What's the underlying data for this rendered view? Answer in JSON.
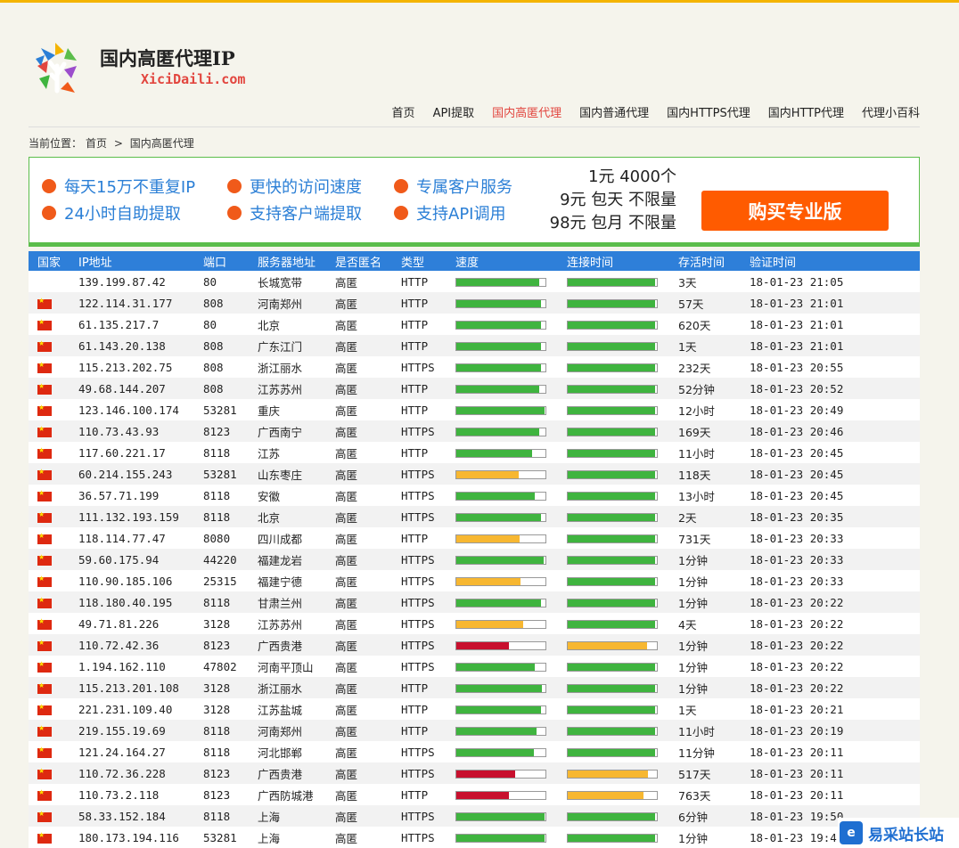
{
  "site": {
    "title": "国内高匿代理IP",
    "domain": "XiciDaili.com"
  },
  "nav": [
    {
      "label": "首页",
      "active": false
    },
    {
      "label": "API提取",
      "active": false
    },
    {
      "label": "国内高匿代理",
      "active": true
    },
    {
      "label": "国内普通代理",
      "active": false
    },
    {
      "label": "国内HTTPS代理",
      "active": false
    },
    {
      "label": "国内HTTP代理",
      "active": false
    },
    {
      "label": "代理小百科",
      "active": false
    }
  ],
  "breadcrumb": {
    "prefix": "当前位置：",
    "home": "首页",
    "sep": ">",
    "current": "国内高匿代理"
  },
  "promo": {
    "features": [
      "每天15万不重复IP",
      "更快的访问速度",
      "专属客户服务",
      "24小时自助提取",
      "支持客户端提取",
      "支持API调用"
    ],
    "prices": [
      "1元 4000个",
      "9元 包天 不限量",
      "98元 包月 不限量"
    ],
    "buy_label": "购买专业版"
  },
  "table": {
    "headers": [
      "国家",
      "IP地址",
      "端口",
      "服务器地址",
      "是否匿名",
      "类型",
      "速度",
      "连接时间",
      "存活时间",
      "验证时间"
    ],
    "rows": [
      {
        "flag": false,
        "ip": "139.199.87.42",
        "port": "80",
        "loc": "长城宽带",
        "anon": "高匿",
        "type": "HTTP",
        "speed": 0.93,
        "speed_color": "green",
        "conn": 0.98,
        "conn_color": "green",
        "alive": "3天",
        "verify": "18-01-23 21:05"
      },
      {
        "flag": true,
        "ip": "122.114.31.177",
        "port": "808",
        "loc": "河南郑州",
        "anon": "高匿",
        "type": "HTTP",
        "speed": 0.95,
        "speed_color": "green",
        "conn": 0.98,
        "conn_color": "green",
        "alive": "57天",
        "verify": "18-01-23 21:01"
      },
      {
        "flag": true,
        "ip": "61.135.217.7",
        "port": "80",
        "loc": "北京",
        "anon": "高匿",
        "type": "HTTP",
        "speed": 0.95,
        "speed_color": "green",
        "conn": 0.98,
        "conn_color": "green",
        "alive": "620天",
        "verify": "18-01-23 21:01"
      },
      {
        "flag": true,
        "ip": "61.143.20.138",
        "port": "808",
        "loc": "广东江门",
        "anon": "高匿",
        "type": "HTTP",
        "speed": 0.95,
        "speed_color": "green",
        "conn": 0.98,
        "conn_color": "green",
        "alive": "1天",
        "verify": "18-01-23 21:01"
      },
      {
        "flag": true,
        "ip": "115.213.202.75",
        "port": "808",
        "loc": "浙江丽水",
        "anon": "高匿",
        "type": "HTTPS",
        "speed": 0.95,
        "speed_color": "green",
        "conn": 0.98,
        "conn_color": "green",
        "alive": "232天",
        "verify": "18-01-23 20:55"
      },
      {
        "flag": true,
        "ip": "49.68.144.207",
        "port": "808",
        "loc": "江苏苏州",
        "anon": "高匿",
        "type": "HTTP",
        "speed": 0.93,
        "speed_color": "green",
        "conn": 0.98,
        "conn_color": "green",
        "alive": "52分钟",
        "verify": "18-01-23 20:52"
      },
      {
        "flag": true,
        "ip": "123.146.100.174",
        "port": "53281",
        "loc": "重庆",
        "anon": "高匿",
        "type": "HTTP",
        "speed": 0.99,
        "speed_color": "green",
        "conn": 0.98,
        "conn_color": "green",
        "alive": "12小时",
        "verify": "18-01-23 20:49"
      },
      {
        "flag": true,
        "ip": "110.73.43.93",
        "port": "8123",
        "loc": "广西南宁",
        "anon": "高匿",
        "type": "HTTPS",
        "speed": 0.93,
        "speed_color": "green",
        "conn": 0.98,
        "conn_color": "green",
        "alive": "169天",
        "verify": "18-01-23 20:46"
      },
      {
        "flag": true,
        "ip": "117.60.221.17",
        "port": "8118",
        "loc": "江苏",
        "anon": "高匿",
        "type": "HTTP",
        "speed": 0.85,
        "speed_color": "green",
        "conn": 0.98,
        "conn_color": "green",
        "alive": "11小时",
        "verify": "18-01-23 20:45"
      },
      {
        "flag": true,
        "ip": "60.214.155.243",
        "port": "53281",
        "loc": "山东枣庄",
        "anon": "高匿",
        "type": "HTTPS",
        "speed": 0.7,
        "speed_color": "orange",
        "conn": 0.98,
        "conn_color": "green",
        "alive": "118天",
        "verify": "18-01-23 20:45"
      },
      {
        "flag": true,
        "ip": "36.57.71.199",
        "port": "8118",
        "loc": "安徽",
        "anon": "高匿",
        "type": "HTTPS",
        "speed": 0.88,
        "speed_color": "green",
        "conn": 0.98,
        "conn_color": "green",
        "alive": "13小时",
        "verify": "18-01-23 20:45"
      },
      {
        "flag": true,
        "ip": "111.132.193.159",
        "port": "8118",
        "loc": "北京",
        "anon": "高匿",
        "type": "HTTPS",
        "speed": 0.95,
        "speed_color": "green",
        "conn": 0.98,
        "conn_color": "green",
        "alive": "2天",
        "verify": "18-01-23 20:35"
      },
      {
        "flag": true,
        "ip": "118.114.77.47",
        "port": "8080",
        "loc": "四川成都",
        "anon": "高匿",
        "type": "HTTP",
        "speed": 0.71,
        "speed_color": "orange",
        "conn": 0.98,
        "conn_color": "green",
        "alive": "731天",
        "verify": "18-01-23 20:33"
      },
      {
        "flag": true,
        "ip": "59.60.175.94",
        "port": "44220",
        "loc": "福建龙岩",
        "anon": "高匿",
        "type": "HTTPS",
        "speed": 0.98,
        "speed_color": "green",
        "conn": 0.98,
        "conn_color": "green",
        "alive": "1分钟",
        "verify": "18-01-23 20:33"
      },
      {
        "flag": true,
        "ip": "110.90.185.106",
        "port": "25315",
        "loc": "福建宁德",
        "anon": "高匿",
        "type": "HTTPS",
        "speed": 0.72,
        "speed_color": "orange",
        "conn": 0.98,
        "conn_color": "green",
        "alive": "1分钟",
        "verify": "18-01-23 20:33"
      },
      {
        "flag": true,
        "ip": "118.180.40.195",
        "port": "8118",
        "loc": "甘肃兰州",
        "anon": "高匿",
        "type": "HTTPS",
        "speed": 0.95,
        "speed_color": "green",
        "conn": 0.98,
        "conn_color": "green",
        "alive": "1分钟",
        "verify": "18-01-23 20:22"
      },
      {
        "flag": true,
        "ip": "49.71.81.226",
        "port": "3128",
        "loc": "江苏苏州",
        "anon": "高匿",
        "type": "HTTPS",
        "speed": 0.75,
        "speed_color": "orange",
        "conn": 0.98,
        "conn_color": "green",
        "alive": "4天",
        "verify": "18-01-23 20:22"
      },
      {
        "flag": true,
        "ip": "110.72.42.36",
        "port": "8123",
        "loc": "广西贵港",
        "anon": "高匿",
        "type": "HTTPS",
        "speed": 0.59,
        "speed_color": "red",
        "conn": 0.89,
        "conn_color": "orange",
        "alive": "1分钟",
        "verify": "18-01-23 20:22"
      },
      {
        "flag": true,
        "ip": "1.194.162.110",
        "port": "47802",
        "loc": "河南平顶山",
        "anon": "高匿",
        "type": "HTTPS",
        "speed": 0.88,
        "speed_color": "green",
        "conn": 0.98,
        "conn_color": "green",
        "alive": "1分钟",
        "verify": "18-01-23 20:22"
      },
      {
        "flag": true,
        "ip": "115.213.201.108",
        "port": "3128",
        "loc": "浙江丽水",
        "anon": "高匿",
        "type": "HTTP",
        "speed": 0.96,
        "speed_color": "green",
        "conn": 0.98,
        "conn_color": "green",
        "alive": "1分钟",
        "verify": "18-01-23 20:22"
      },
      {
        "flag": true,
        "ip": "221.231.109.40",
        "port": "3128",
        "loc": "江苏盐城",
        "anon": "高匿",
        "type": "HTTP",
        "speed": 0.95,
        "speed_color": "green",
        "conn": 0.98,
        "conn_color": "green",
        "alive": "1天",
        "verify": "18-01-23 20:21"
      },
      {
        "flag": true,
        "ip": "219.155.19.69",
        "port": "8118",
        "loc": "河南郑州",
        "anon": "高匿",
        "type": "HTTP",
        "speed": 0.9,
        "speed_color": "green",
        "conn": 0.98,
        "conn_color": "green",
        "alive": "11小时",
        "verify": "18-01-23 20:19"
      },
      {
        "flag": true,
        "ip": "121.24.164.27",
        "port": "8118",
        "loc": "河北邯郸",
        "anon": "高匿",
        "type": "HTTPS",
        "speed": 0.87,
        "speed_color": "green",
        "conn": 0.98,
        "conn_color": "green",
        "alive": "11分钟",
        "verify": "18-01-23 20:11"
      },
      {
        "flag": true,
        "ip": "110.72.36.228",
        "port": "8123",
        "loc": "广西贵港",
        "anon": "高匿",
        "type": "HTTPS",
        "speed": 0.66,
        "speed_color": "red",
        "conn": 0.9,
        "conn_color": "orange",
        "alive": "517天",
        "verify": "18-01-23 20:11"
      },
      {
        "flag": true,
        "ip": "110.73.2.118",
        "port": "8123",
        "loc": "广西防城港",
        "anon": "高匿",
        "type": "HTTP",
        "speed": 0.59,
        "speed_color": "red",
        "conn": 0.85,
        "conn_color": "orange",
        "alive": "763天",
        "verify": "18-01-23 20:11"
      },
      {
        "flag": true,
        "ip": "58.33.152.184",
        "port": "8118",
        "loc": "上海",
        "anon": "高匿",
        "type": "HTTPS",
        "speed": 0.99,
        "speed_color": "green",
        "conn": 0.98,
        "conn_color": "green",
        "alive": "6分钟",
        "verify": "18-01-23 19:50"
      },
      {
        "flag": true,
        "ip": "180.173.194.116",
        "port": "53281",
        "loc": "上海",
        "anon": "高匿",
        "type": "HTTPS",
        "speed": 0.99,
        "speed_color": "green",
        "conn": 0.98,
        "conn_color": "green",
        "alive": "1分钟",
        "verify": "18-01-23 19:4"
      }
    ]
  },
  "watermark": {
    "label": "易采站长站",
    "icon_name": "e-icon"
  },
  "colors": {
    "accent": "#2e7fd9",
    "green": "#3fb43f",
    "orange": "#f7b731",
    "red": "#c8102e",
    "buy": "#ff5b00"
  }
}
